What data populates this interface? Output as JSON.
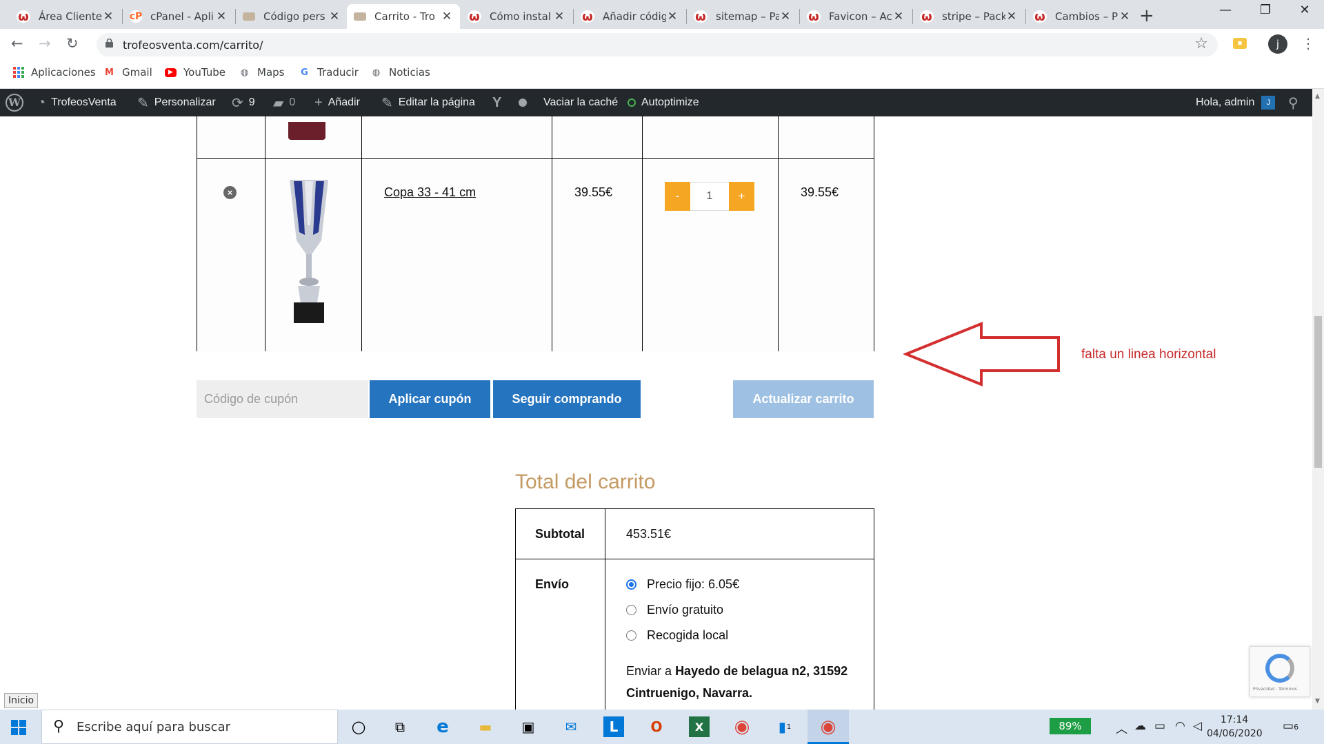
{
  "browser": {
    "tabs": [
      {
        "title": "Área Cliente",
        "icon": "wordfence-icon"
      },
      {
        "title": "cPanel - Apli",
        "icon": "cpanel-icon"
      },
      {
        "title": "Código pers",
        "icon": "page-icon"
      },
      {
        "title": "Carrito - Tro",
        "icon": "page-icon",
        "active": true
      },
      {
        "title": "Cómo instal",
        "icon": "wordfence-icon"
      },
      {
        "title": "Añadir códig",
        "icon": "wordfence-icon"
      },
      {
        "title": "sitemap – Pa",
        "icon": "wordfence-icon"
      },
      {
        "title": "Favicon – Ac",
        "icon": "wordfence-icon"
      },
      {
        "title": "stripe – Pack",
        "icon": "wordfence-icon"
      },
      {
        "title": "Cambios – P",
        "icon": "wordfence-icon"
      }
    ],
    "url": "trofeosventa.com/carrito/",
    "profile_initial": "j",
    "bookmarks": [
      "Aplicaciones",
      "Gmail",
      "YouTube",
      "Maps",
      "Traducir",
      "Noticias"
    ]
  },
  "wp_admin_bar": {
    "site_name": "TrofeosVenta",
    "customize": "Personalizar",
    "updates_count": "9",
    "comments_count": "0",
    "add_new": "Añadir",
    "edit_page": "Editar la página",
    "clear_cache": "Vaciar la caché",
    "autoptimize": "Autoptimize",
    "greeting": "Hola, admin",
    "avatar_initial": "J"
  },
  "cart": {
    "item": {
      "name": "Copa 33 - 41 cm",
      "price": "39.55€",
      "quantity": "1",
      "subtotal": "39.55€",
      "minus": "-",
      "plus": "+",
      "remove": "×"
    },
    "coupon_placeholder": "Código de cupón",
    "apply_coupon": "Aplicar cupón",
    "continue_shopping": "Seguir comprando",
    "update_cart": "Actualizar carrito"
  },
  "annotation": {
    "text": "falta un linea horizontal",
    "color": "#c62828"
  },
  "totals": {
    "title": "Total del carrito",
    "subtotal_label": "Subtotal",
    "subtotal_value": "453.51€",
    "shipping_label": "Envío",
    "shipping_options": [
      "Precio fijo: 6.05€",
      "Envío gratuito",
      "Recogida local"
    ],
    "selected_shipping": "Precio fijo: 6.05€",
    "ship_to_prefix": "Enviar a",
    "ship_to_address_line1": "Hayedo de belagua n2, 31592",
    "ship_to_address_line2": "Cintruenigo, Navarra."
  },
  "status_tooltip": "Inicio",
  "recaptcha_text": "Privacidad - Términos",
  "taskbar": {
    "search_placeholder": "Escribe aquí para buscar",
    "battery": "89%",
    "time": "17:14",
    "date": "04/06/2020",
    "notifications": "6",
    "explorer_badge": "1"
  },
  "colors": {
    "button_blue": "#2574bf",
    "button_disabled": "#9ec0e2",
    "qty_orange": "#f5a623",
    "heading_gold": "#c49a63",
    "wp_bar": "#23282d"
  }
}
